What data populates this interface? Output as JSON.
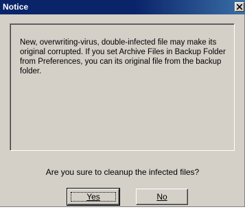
{
  "dialog": {
    "title": "Notice",
    "message": "New, overwriting-virus, double-infected file may make its original corrupted. If you set Archive Files in Backup Folder from Preferences, you can its original file from the backup folder.",
    "question": "Are you sure to cleanup the infected files?"
  },
  "buttons": {
    "yes_label": "Yes",
    "no_label": "No"
  },
  "icons": {
    "close": "close-icon"
  },
  "colors": {
    "titlebar": "#0a246a",
    "titlebar_gradient_end": "#3a6ea5",
    "face": "#d4d0c8"
  }
}
